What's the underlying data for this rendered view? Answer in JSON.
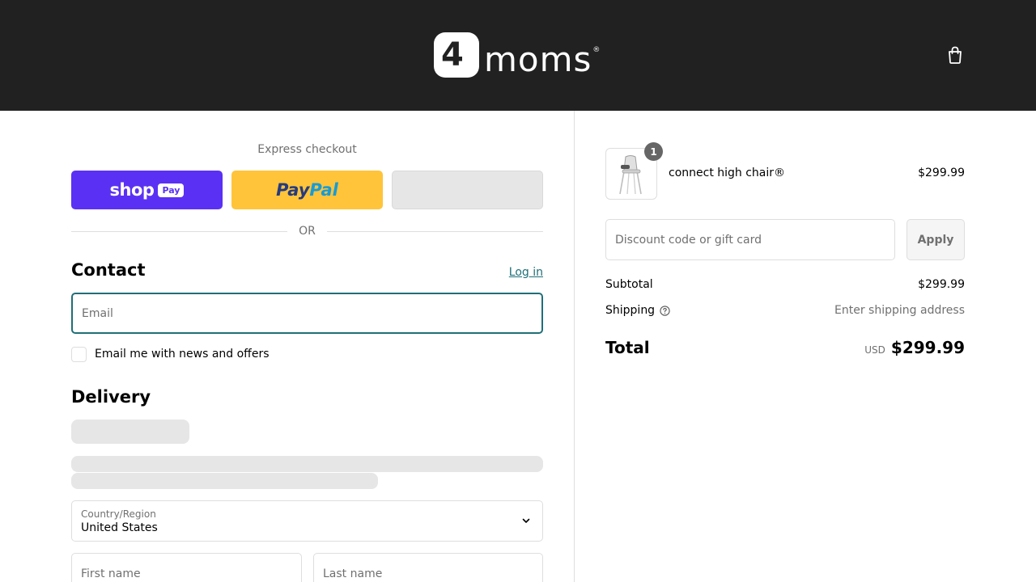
{
  "header": {
    "logo_text": "moms",
    "logo_mark": "4",
    "logo_tm": "®",
    "cart_icon": "shopping-bag-icon"
  },
  "express": {
    "label": "Express checkout",
    "shop_pay": {
      "shop": "shop",
      "pay": "Pay"
    },
    "paypal": {
      "pay": "Pay",
      "pal": "Pal"
    },
    "or_label": "OR"
  },
  "contact": {
    "title": "Contact",
    "login_link": "Log in",
    "email_placeholder": "Email",
    "newsletter_label": "Email me with news and offers",
    "newsletter_checked": false
  },
  "delivery": {
    "title": "Delivery",
    "country": {
      "label": "Country/Region",
      "value": "United States"
    },
    "first_name_placeholder": "First name",
    "last_name_placeholder": "Last name"
  },
  "order": {
    "product": {
      "name": "connect high chair®",
      "price": "$299.99",
      "quantity": "1"
    },
    "discount_placeholder": "Discount code or gift card",
    "apply_label": "Apply",
    "subtotal_label": "Subtotal",
    "subtotal_value": "$299.99",
    "shipping_label": "Shipping",
    "shipping_value": "Enter shipping address",
    "total_label": "Total",
    "total_currency": "USD",
    "total_value": "$299.99"
  },
  "colors": {
    "header_bg": "#212121",
    "shop_pay": "#5a31f4",
    "paypal": "#ffc439",
    "accent": "#1f6f78"
  }
}
